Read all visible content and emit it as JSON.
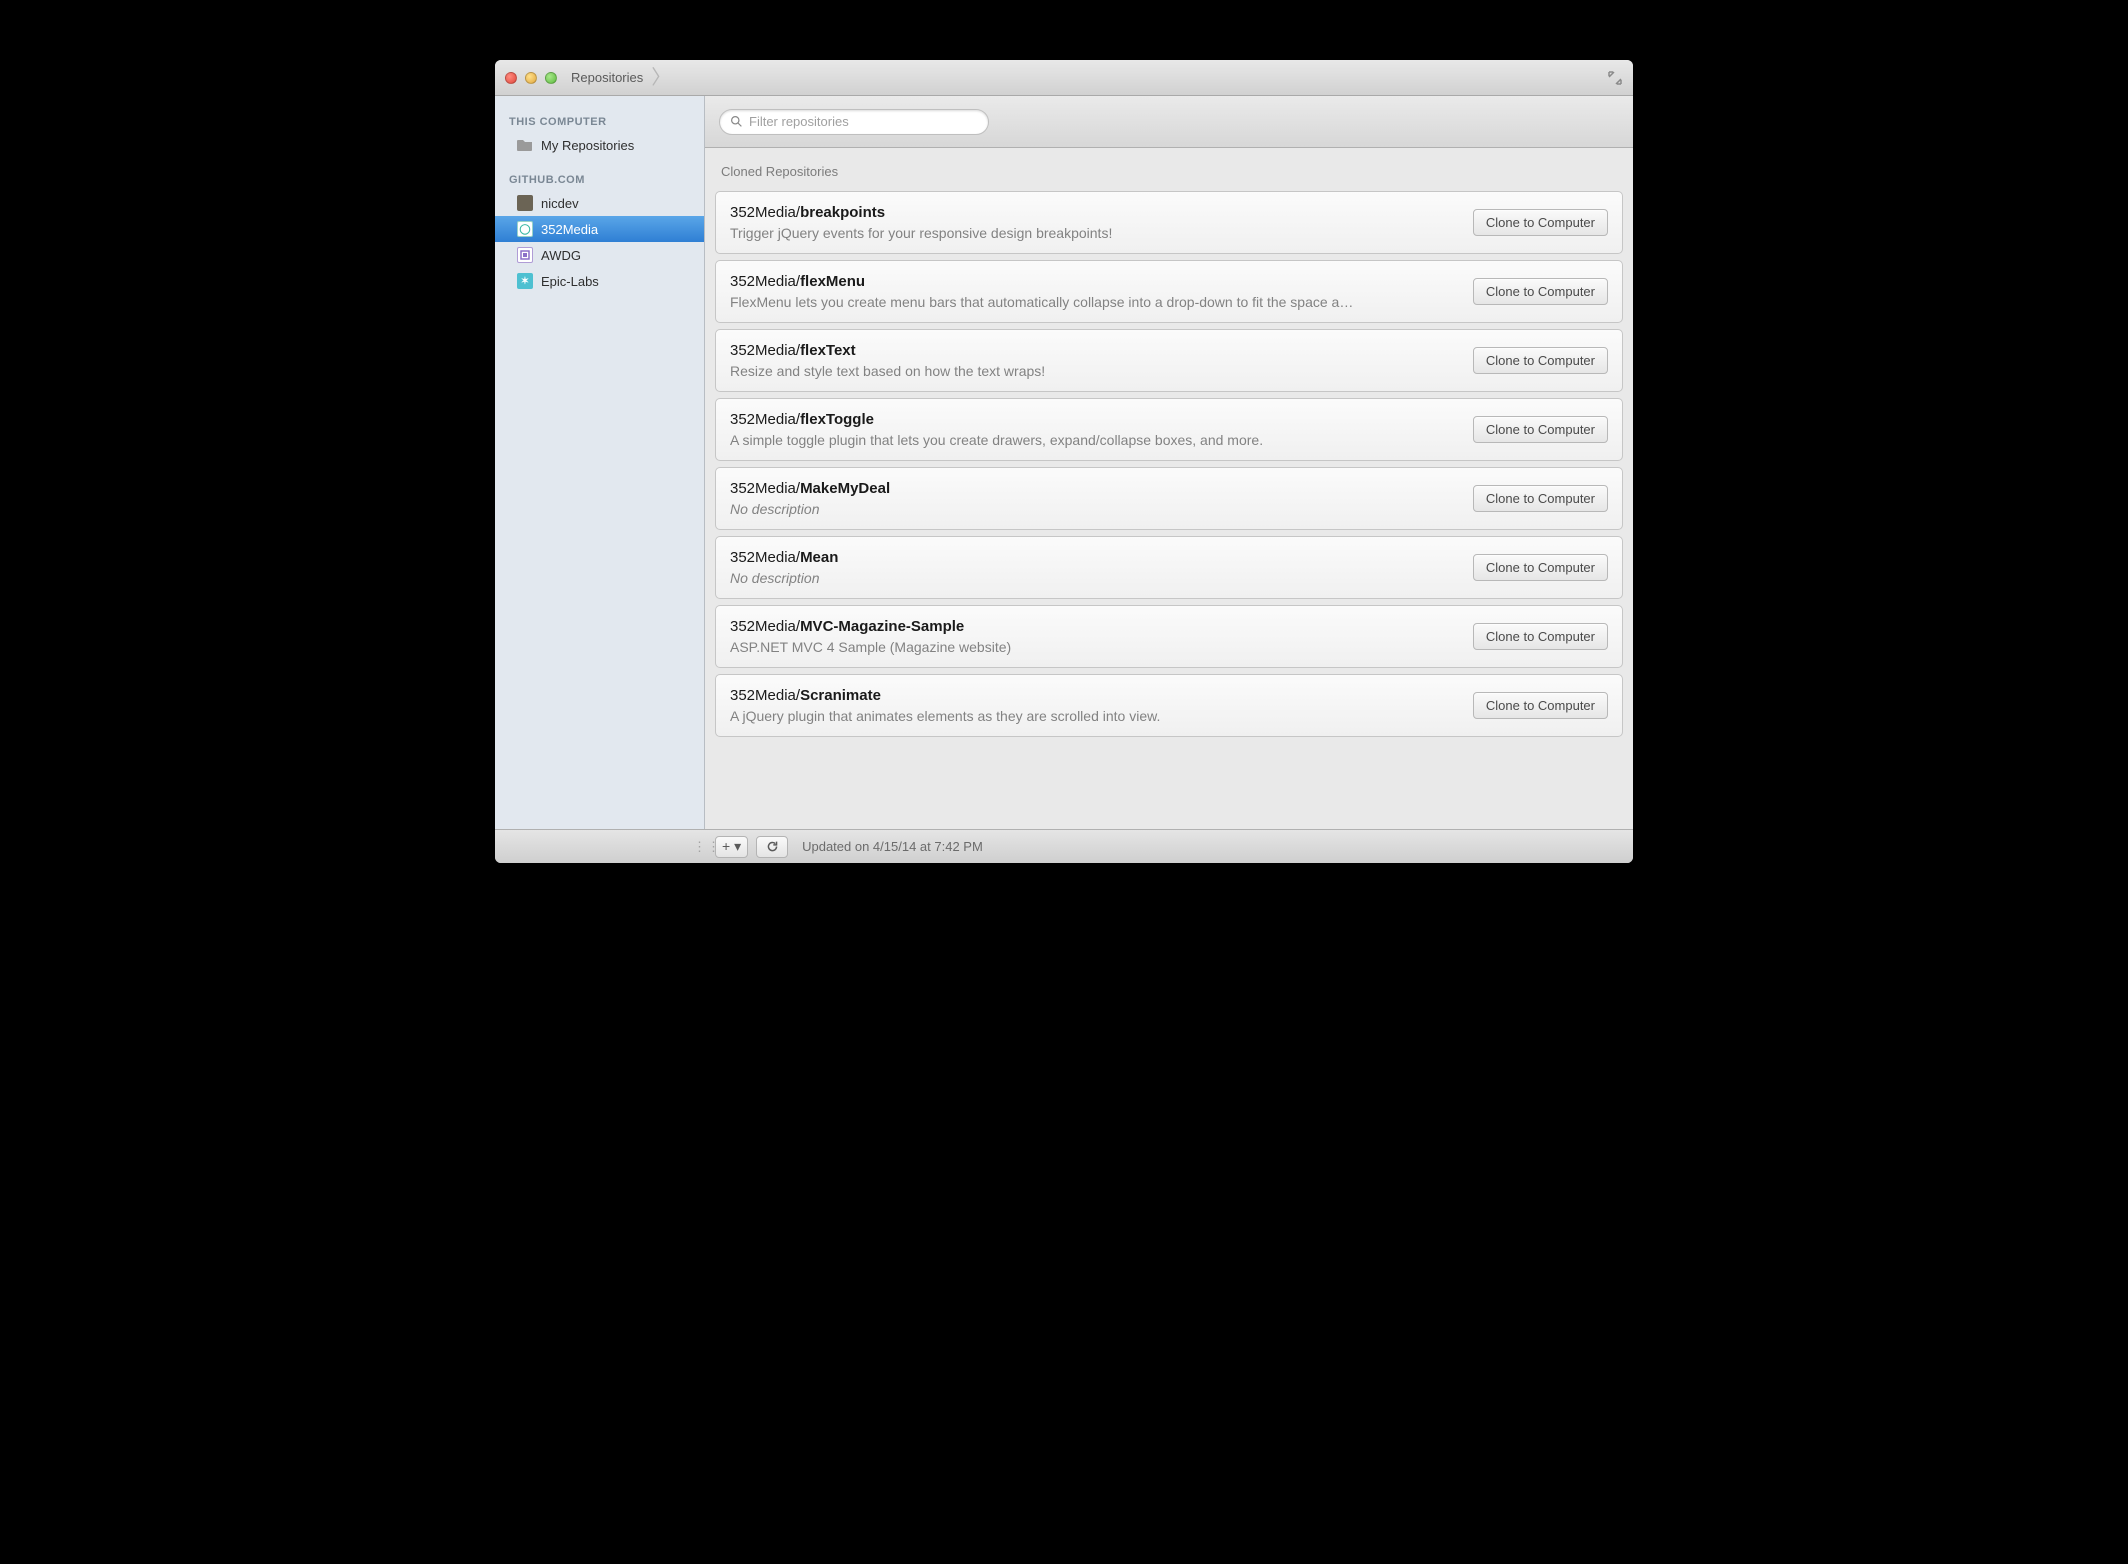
{
  "window": {
    "breadcrumb": "Repositories"
  },
  "sidebar": {
    "section_this_computer": "THIS COMPUTER",
    "my_repositories": "My Repositories",
    "section_github": "GITHUB.COM",
    "accounts": [
      {
        "label": "nicdev"
      },
      {
        "label": "352Media"
      },
      {
        "label": "AWDG"
      },
      {
        "label": "Epic-Labs"
      }
    ]
  },
  "filter": {
    "placeholder": "Filter repositories"
  },
  "main": {
    "section_label": "Cloned Repositories",
    "clone_label": "Clone to Computer",
    "no_description": "No description",
    "repos": [
      {
        "owner": "352Media",
        "name": "breakpoints",
        "desc": "Trigger jQuery events for your responsive design breakpoints!"
      },
      {
        "owner": "352Media",
        "name": "flexMenu",
        "desc": "FlexMenu lets you create menu bars that automatically collapse into a drop-down to fit the space a…"
      },
      {
        "owner": "352Media",
        "name": "flexText",
        "desc": "Resize and style text based on how the text wraps!"
      },
      {
        "owner": "352Media",
        "name": "flexToggle",
        "desc": "A simple toggle plugin that lets you create drawers, expand/collapse boxes, and more."
      },
      {
        "owner": "352Media",
        "name": "MakeMyDeal",
        "desc": null
      },
      {
        "owner": "352Media",
        "name": "Mean",
        "desc": null
      },
      {
        "owner": "352Media",
        "name": "MVC-Magazine-Sample",
        "desc": "ASP.NET MVC 4 Sample (Magazine website)"
      },
      {
        "owner": "352Media",
        "name": "Scranimate",
        "desc": "A jQuery plugin that animates elements as they are scrolled into view."
      }
    ]
  },
  "statusbar": {
    "updated": "Updated on 4/15/14 at 7:42 PM"
  }
}
